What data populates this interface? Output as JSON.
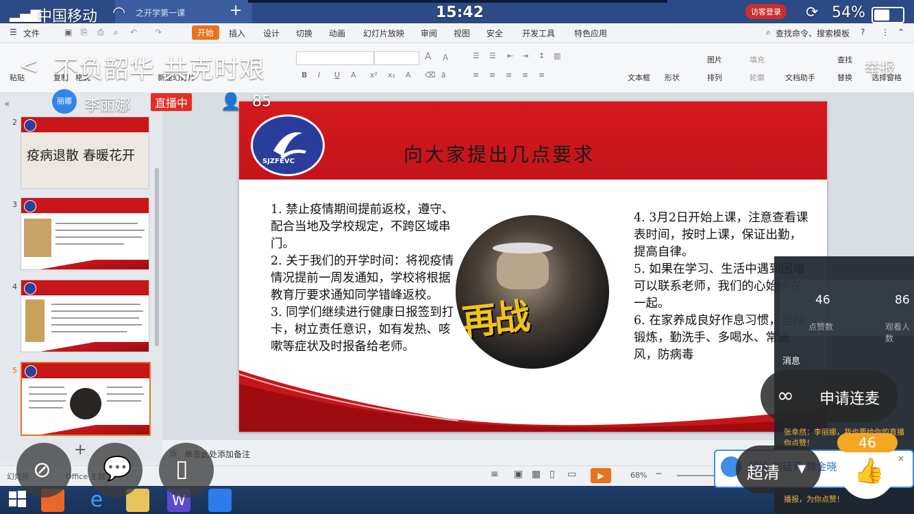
{
  "phone_status": {
    "carrier": "中国移动",
    "time": "15:42",
    "battery": "54%"
  },
  "window": {
    "tab_title": "之开学第一课",
    "guest_login": "访客登录"
  },
  "menubar": {
    "file": "文件",
    "items": [
      "开始",
      "插入",
      "设计",
      "切换",
      "动画",
      "幻灯片放映",
      "审阅",
      "视图",
      "安全",
      "开发工具",
      "特色应用"
    ],
    "search": "查找命令、搜索模板"
  },
  "ribbon": {
    "paste": "粘贴",
    "copy": "复制",
    "format": "格式",
    "new_slide": "新建幻灯片",
    "textbox": "文本框",
    "shape": "形状",
    "picture": "图片",
    "arrange": "排列",
    "fill": "填充",
    "outline": "轮廓",
    "doc_assistant": "文档助手",
    "find": "查找",
    "replace": "替换",
    "select_pane": "选择窗格"
  },
  "thumbnails": [
    {
      "number": "2",
      "text": "疫病退散 春暖花开"
    },
    {
      "number": "3",
      "text": ""
    },
    {
      "number": "4",
      "text": ""
    },
    {
      "number": "5",
      "text": ""
    }
  ],
  "slide": {
    "logo_text": "SJZFEVC",
    "title": "向大家提出几点要求",
    "left_text": "1. 禁止疫情期间提前返校，遵守、配合当地及学校规定，不跨区域串门。\n2. 关于我们的开学时间：将视疫情情况提前一周发通知，学校将根据教育厅要求通知同学错峰返校。\n3. 同学们继续进行健康日报签到打卡，树立责任意识，如有发热、咳嗽等症状及时报备给老师。",
    "right_text": "4. 3月2日开始上课，注意查看课表时间，按时上课，保证出勤，提高自律。\n5. 如果在学习、生活中遇到困难可以联系老师，我们的心始终在一起。\n6. 在家养成良好作息习惯，坚持锻炼，勤洗手、多喝水、常通风，防病毒",
    "photo_stamp": "再战"
  },
  "notes_placeholder": "单击此处添加备注",
  "status": {
    "slide_label": "幻灯片",
    "theme": "Office 主题",
    "zoom": "68%"
  },
  "live": {
    "room_title": "不负韶华 共克时艰",
    "host_avatar_text": "丽娜",
    "host_name": "李丽娜",
    "live_badge": "直播中",
    "viewers": "85",
    "report": "举报",
    "likes_stat": "46",
    "likes_label": "点赞数",
    "viewers_stat": "86",
    "viewers_label": "观看人数",
    "messages_label": "消息",
    "request_mic": "申请连麦",
    "hd": "超清",
    "like_count": "46",
    "chat_banner": "超级 刘廷莉 魏金晓",
    "chat_line": "张幸然：李丽娜，我也要给你的直播 你点赞！",
    "chat_line2": "播报，为你点赞！"
  }
}
